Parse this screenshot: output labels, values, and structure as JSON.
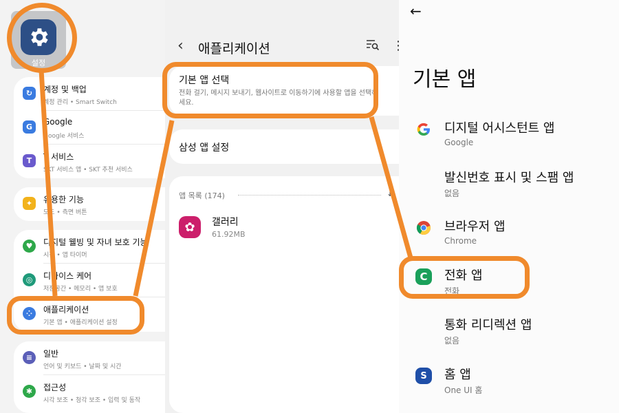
{
  "left_panel": {
    "settings_app_label": "설정",
    "items": [
      {
        "title": "계정 및 백업",
        "subtitle": "계정 관리 • Smart Switch",
        "icon": "sync-icon",
        "color": "#3a7be0"
      },
      {
        "title": "Google",
        "subtitle": "Google 서비스",
        "icon": "google-g-icon",
        "color": "#3a7be0"
      },
      {
        "title": "T 서비스",
        "subtitle": "SKT 서비스 앱 • SKT 추천 서비스",
        "icon": "t-service-icon",
        "color": "#6a5acd"
      },
      {
        "title": "유용한 기능",
        "subtitle": "모드 • 측면 버튼",
        "icon": "star-plus-icon",
        "color": "#f2b21b"
      },
      {
        "title": "디지털 웰빙 및 자녀 보호 기능",
        "subtitle": "시간 • 앱 타이머",
        "icon": "wellbeing-icon",
        "color": "#2ea84a"
      },
      {
        "title": "디바이스 케어",
        "subtitle": "저장공간 • 메모리 • 앱 보호",
        "icon": "device-care-icon",
        "color": "#1f9a7a"
      },
      {
        "title": "애플리케이션",
        "subtitle": "기본 앱 • 애플리케이션 설정",
        "icon": "apps-grid-icon",
        "color": "#3a7be0"
      },
      {
        "title": "일반",
        "subtitle": "언어 및 키보드 • 날짜 및 시간",
        "icon": "sliders-icon",
        "color": "#5b5fb8"
      },
      {
        "title": "접근성",
        "subtitle": "시각 보조 • 청각 보조 • 입력 및 동작",
        "icon": "accessibility-icon",
        "color": "#2ea84a"
      }
    ]
  },
  "middle_panel": {
    "title": "애플리케이션",
    "default_apps": {
      "title": "기본 앱 선택",
      "description": "전화 걸기, 메시지 보내기, 웹사이트로 이동하기에 사용할 앱을 선택하세요."
    },
    "samsung_settings": "삼성 앱 설정",
    "app_list_label": "앱 목록 (174)",
    "app": {
      "name": "갤러리",
      "size": "61.92MB",
      "color": "#cc1f6b"
    }
  },
  "right_panel": {
    "title": "기본 앱",
    "items": [
      {
        "title": "디지털 어시스턴트 앱",
        "subtitle": "Google",
        "icon": "google-g-icon"
      },
      {
        "title": "발신번호 표시 및 스팸 앱",
        "subtitle": "없음",
        "icon": ""
      },
      {
        "title": "브라우저 앱",
        "subtitle": "Chrome",
        "icon": "chrome-icon"
      },
      {
        "title": "전화 앱",
        "subtitle": "전화",
        "icon": "phone-app-icon"
      },
      {
        "title": "통화 리디렉션 앱",
        "subtitle": "없음",
        "icon": ""
      },
      {
        "title": "홈 앱",
        "subtitle": "One UI 홈",
        "icon": "samsung-home-icon"
      }
    ]
  },
  "colors": {
    "highlight": "#f08a2c",
    "phone_green": "#1aa05a",
    "home_blue": "#1f4fa8"
  }
}
